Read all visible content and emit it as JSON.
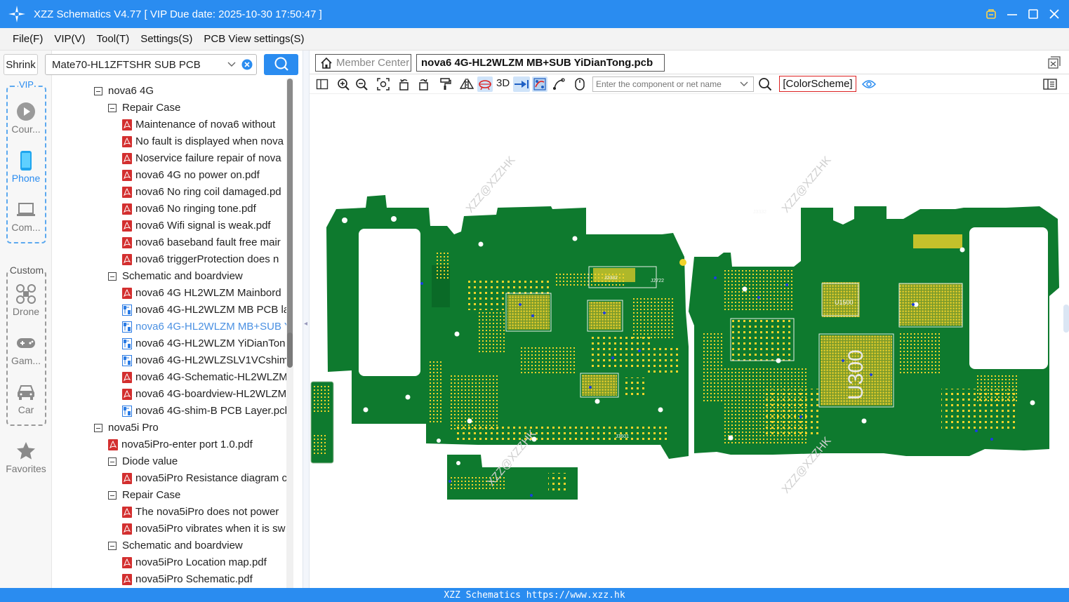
{
  "window": {
    "title": "XZZ Schematics V4.77 [ VIP Due date: 2025-10-30 17:50:47 ]"
  },
  "menu": [
    "File(F)",
    "VIP(V)",
    "Tool(T)",
    "Settings(S)",
    "PCB View settings(S)"
  ],
  "sidebar": {
    "shrink_label": "Shrink",
    "vip_label": "VIP",
    "custom_label": "Custom",
    "vip_items": [
      {
        "label": "Cour...",
        "icon": "play-icon"
      },
      {
        "label": "Phone",
        "icon": "phone-icon"
      },
      {
        "label": "Com...",
        "icon": "laptop-icon"
      }
    ],
    "custom_items": [
      {
        "label": "Drone",
        "icon": "drone-icon"
      },
      {
        "label": "Gam...",
        "icon": "gamepad-icon"
      },
      {
        "label": "Car",
        "icon": "car-icon"
      }
    ],
    "favorites_label": "Favorites"
  },
  "model_search": {
    "value": "Mate70-HL1ZFTSHR SUB PCB"
  },
  "tree": [
    {
      "label": "nova6 4G",
      "type": "folder",
      "level": 1
    },
    {
      "label": "Repair Case",
      "type": "folder",
      "level": 2
    },
    {
      "label": "Maintenance of nova6 without",
      "type": "pdf",
      "level": 3
    },
    {
      "label": "No fault is displayed when nova",
      "type": "pdf",
      "level": 3
    },
    {
      "label": "Noservice failure repair of nova",
      "type": "pdf",
      "level": 3
    },
    {
      "label": "nova6 4G no power on.pdf",
      "type": "pdf",
      "level": 3
    },
    {
      "label": "nova6 No ring coil damaged.pd",
      "type": "pdf",
      "level": 3
    },
    {
      "label": "nova6 No ringing tone.pdf",
      "type": "pdf",
      "level": 3
    },
    {
      "label": "nova6 Wifi signal is weak.pdf",
      "type": "pdf",
      "level": 3
    },
    {
      "label": "nova6 baseband fault free mair",
      "type": "pdf",
      "level": 3
    },
    {
      "label": "nova6 triggerProtection does n",
      "type": "pdf",
      "level": 3
    },
    {
      "label": "Schematic and boardview",
      "type": "folder",
      "level": 2
    },
    {
      "label": "nova6 4G HL2WLZM Mainbord",
      "type": "pdf",
      "level": 3
    },
    {
      "label": "nova6 4G-HL2WLZM MB PCB la",
      "type": "pcb",
      "level": 3
    },
    {
      "label": "nova6 4G-HL2WLZM MB+SUB Y",
      "type": "pcb",
      "level": 3,
      "selected": true
    },
    {
      "label": "nova6 4G-HL2WLZM YiDianTon",
      "type": "pcb",
      "level": 3
    },
    {
      "label": "nova6 4G-HL2WLZSLV1VCshim-",
      "type": "pcb",
      "level": 3
    },
    {
      "label": "nova6 4G-Schematic-HL2WLZM",
      "type": "pdf",
      "level": 3
    },
    {
      "label": "nova6 4G-boardview-HL2WLZM",
      "type": "pdf",
      "level": 3
    },
    {
      "label": "nova6 4G-shim-B PCB Layer.pcb",
      "type": "pcb",
      "level": 3
    },
    {
      "label": "nova5i Pro",
      "type": "folder",
      "level": 1
    },
    {
      "label": "nova5iPro-enter port 1.0.pdf",
      "type": "pdf",
      "level": 2
    },
    {
      "label": "Diode value",
      "type": "folder",
      "level": 2
    },
    {
      "label": "nova5iPro Resistance diagram c",
      "type": "pdf",
      "level": 3
    },
    {
      "label": "Repair Case",
      "type": "folder",
      "level": 2
    },
    {
      "label": "The nova5iPro does not power",
      "type": "pdf",
      "level": 3
    },
    {
      "label": "nova5iPro vibrates when it is sw",
      "type": "pdf",
      "level": 3
    },
    {
      "label": "Schematic and boardview",
      "type": "folder",
      "level": 2
    },
    {
      "label": "nova5iPro Location map.pdf",
      "type": "pdf",
      "level": 3
    },
    {
      "label": "nova5iPro Schematic.pdf",
      "type": "pdf",
      "level": 3
    }
  ],
  "tabs": {
    "member": "Member Center",
    "active": "nova6 4G-HL2WLZM MB+SUB YiDianTong.pcb"
  },
  "toolbar": {
    "label_3d": "3D",
    "component_search_placeholder": "Enter the component or net name",
    "color_scheme": "[ColorScheme]"
  },
  "pcb": {
    "watermark": "XZZ@XZZHK",
    "labels": [
      "U1500",
      "U300",
      "J2332",
      "J2722",
      "J3601",
      "J3332"
    ],
    "board_color": "#0e7a2e",
    "pad_color": "#f2d32a"
  },
  "status": "XZZ Schematics https://www.xzz.hk",
  "colors": {
    "accent": "#2a8cf0",
    "pdf": "#d32f2f",
    "pcb_file": "#2a7be4"
  }
}
